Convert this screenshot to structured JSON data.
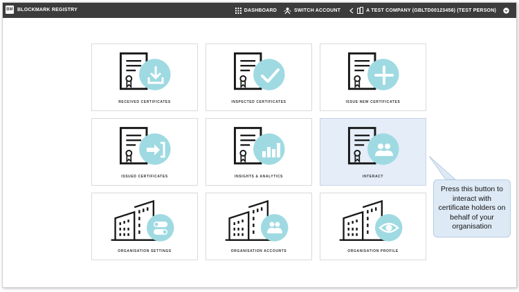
{
  "topbar": {
    "logo_text": "BM",
    "brand": "BLOCKMARK REGISTRY",
    "dashboard_label": "DASHBOARD",
    "switch_account_label": "SWITCH ACCOUNT",
    "account_label": "A TEST COMPANY (GBLTD00123456) (TEST PERSON)"
  },
  "tiles": [
    {
      "label": "RECEIVED CERTIFICATES",
      "icon": "download-icon"
    },
    {
      "label": "INSPECTED CERTIFICATES",
      "icon": "check-icon"
    },
    {
      "label": "ISSUE NEW CERTIFICATES",
      "icon": "plus-icon"
    },
    {
      "label": "ISSUED CERTIFICATES",
      "icon": "send-arrow-icon"
    },
    {
      "label": "INSIGHTS & ANALYTICS",
      "icon": "bar-chart-icon"
    },
    {
      "label": "INTERACT",
      "icon": "people-icon"
    },
    {
      "label": "ORGANISATION SETTINGS",
      "icon": "toggle-icon"
    },
    {
      "label": "ORGANISATION ACCOUNTS",
      "icon": "people-icon"
    },
    {
      "label": "ORGANISATION PROFILE",
      "icon": "eye-icon"
    }
  ],
  "callout": {
    "text": "Press this button to interact with certificate holders on behalf of your organisation"
  },
  "colors": {
    "topbar": "#3c3c3c",
    "badge": "#9fdae2",
    "active_tile": "#e4edf8",
    "callout": "#dde9f5"
  }
}
